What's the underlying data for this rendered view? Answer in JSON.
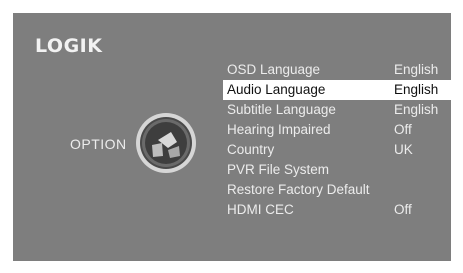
{
  "brand": {
    "logo_text": "LOGIK"
  },
  "category": {
    "label": "OPTION",
    "icon": "option-disc-icon"
  },
  "menu": {
    "selected_index": 1,
    "items": [
      {
        "label": "OSD Language",
        "value": "English"
      },
      {
        "label": "Audio Language",
        "value": "English"
      },
      {
        "label": "Subtitle Language",
        "value": "English"
      },
      {
        "label": "Hearing Impaired",
        "value": "Off"
      },
      {
        "label": "Country",
        "value": "UK"
      },
      {
        "label": "PVR File System",
        "value": ""
      },
      {
        "label": "Restore Factory Default",
        "value": ""
      },
      {
        "label": "HDMI CEC",
        "value": "Off"
      }
    ]
  },
  "colors": {
    "background": "#7e7e7e",
    "text": "#ececec",
    "highlight": "#ffffff",
    "highlight_text": "#111111"
  }
}
